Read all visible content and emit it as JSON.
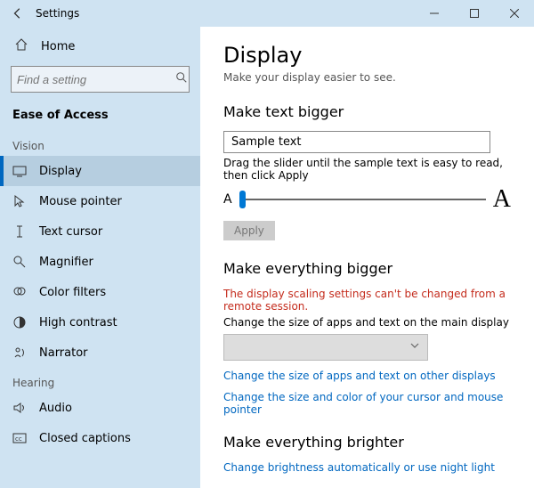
{
  "window": {
    "title": "Settings"
  },
  "sidebar": {
    "home_label": "Home",
    "search_placeholder": "Find a setting",
    "category": "Ease of Access",
    "groups": [
      {
        "label": "Vision",
        "items": [
          {
            "label": "Display",
            "icon": "display-icon",
            "active": true
          },
          {
            "label": "Mouse pointer",
            "icon": "mouse-icon"
          },
          {
            "label": "Text cursor",
            "icon": "textcursor-icon"
          },
          {
            "label": "Magnifier",
            "icon": "magnifier-icon"
          },
          {
            "label": "Color filters",
            "icon": "colorfilters-icon"
          },
          {
            "label": "High contrast",
            "icon": "highcontrast-icon"
          },
          {
            "label": "Narrator",
            "icon": "narrator-icon"
          }
        ]
      },
      {
        "label": "Hearing",
        "items": [
          {
            "label": "Audio",
            "icon": "audio-icon"
          },
          {
            "label": "Closed captions",
            "icon": "cc-icon"
          }
        ]
      }
    ]
  },
  "main": {
    "heading": "Display",
    "subtitle": "Make your display easier to see.",
    "section_text": {
      "heading": "Make text bigger",
      "sample": "Sample text",
      "hint": "Drag the slider until the sample text is easy to read, then click Apply",
      "small_a": "A",
      "big_a": "A",
      "apply": "Apply"
    },
    "section_everything": {
      "heading": "Make everything bigger",
      "error": "The display scaling settings can't be changed from a remote session.",
      "desc": "Change the size of apps and text on the main display",
      "link1": "Change the size of apps and text on other displays",
      "link2": "Change the size and color of your cursor and mouse pointer"
    },
    "section_brightness": {
      "heading": "Make everything brighter",
      "link": "Change brightness automatically or use night light"
    }
  }
}
